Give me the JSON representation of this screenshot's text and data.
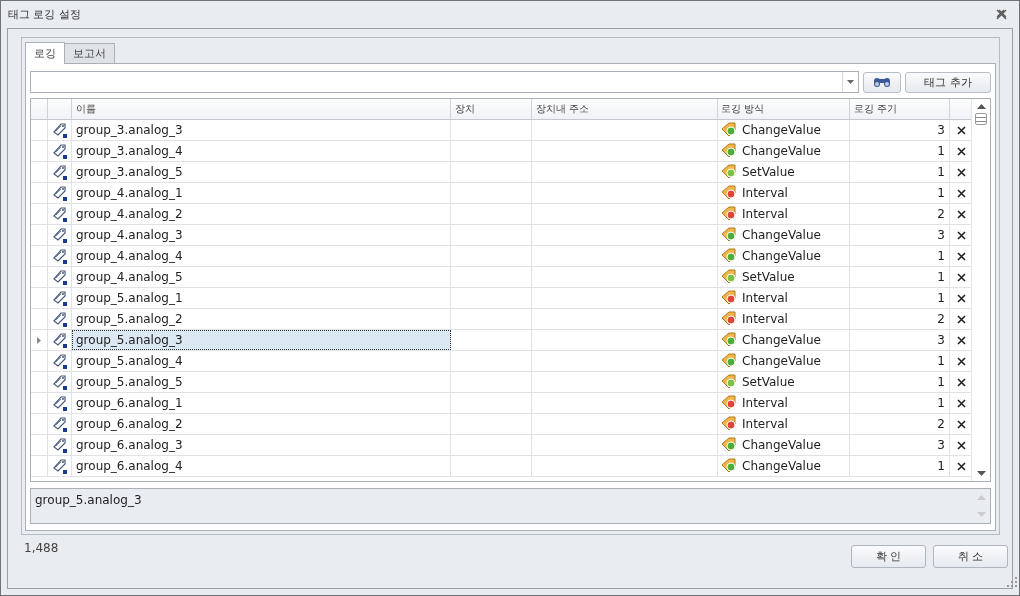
{
  "window": {
    "title": "태그 로깅 설정"
  },
  "tabs": [
    {
      "label": "로깅",
      "selected": true
    },
    {
      "label": "보고서",
      "selected": false
    }
  ],
  "toolbar": {
    "add_button": "태그 추가"
  },
  "table": {
    "columns": [
      "이름",
      "장치",
      "장치내 주소",
      "로깅 방식",
      "로깅 주기"
    ],
    "rows": [
      {
        "name": "group_3.analog_3",
        "method": {
          "kind": "change",
          "label": "ChangeValue"
        },
        "period": "3",
        "selected": false
      },
      {
        "name": "group_3.analog_4",
        "method": {
          "kind": "change",
          "label": "ChangeValue"
        },
        "period": "1",
        "selected": false
      },
      {
        "name": "group_3.analog_5",
        "method": {
          "kind": "set",
          "label": "SetValue"
        },
        "period": "1",
        "selected": false
      },
      {
        "name": "group_4.analog_1",
        "method": {
          "kind": "interval",
          "label": "Interval"
        },
        "period": "1",
        "selected": false
      },
      {
        "name": "group_4.analog_2",
        "method": {
          "kind": "interval",
          "label": "Interval"
        },
        "period": "2",
        "selected": false
      },
      {
        "name": "group_4.analog_3",
        "method": {
          "kind": "change",
          "label": "ChangeValue"
        },
        "period": "3",
        "selected": false
      },
      {
        "name": "group_4.analog_4",
        "method": {
          "kind": "change",
          "label": "ChangeValue"
        },
        "period": "1",
        "selected": false
      },
      {
        "name": "group_4.analog_5",
        "method": {
          "kind": "set",
          "label": "SetValue"
        },
        "period": "1",
        "selected": false
      },
      {
        "name": "group_5.analog_1",
        "method": {
          "kind": "interval",
          "label": "Interval"
        },
        "period": "1",
        "selected": false
      },
      {
        "name": "group_5.analog_2",
        "method": {
          "kind": "interval",
          "label": "Interval"
        },
        "period": "2",
        "selected": false
      },
      {
        "name": "group_5.analog_3",
        "method": {
          "kind": "change",
          "label": "ChangeValue"
        },
        "period": "3",
        "selected": true
      },
      {
        "name": "group_5.analog_4",
        "method": {
          "kind": "change",
          "label": "ChangeValue"
        },
        "period": "1",
        "selected": false
      },
      {
        "name": "group_5.analog_5",
        "method": {
          "kind": "set",
          "label": "SetValue"
        },
        "period": "1",
        "selected": false
      },
      {
        "name": "group_6.analog_1",
        "method": {
          "kind": "interval",
          "label": "Interval"
        },
        "period": "1",
        "selected": false
      },
      {
        "name": "group_6.analog_2",
        "method": {
          "kind": "interval",
          "label": "Interval"
        },
        "period": "2",
        "selected": false
      },
      {
        "name": "group_6.analog_3",
        "method": {
          "kind": "change",
          "label": "ChangeValue"
        },
        "period": "3",
        "selected": false
      },
      {
        "name": "group_6.analog_4",
        "method": {
          "kind": "change",
          "label": "ChangeValue"
        },
        "period": "1",
        "selected": false
      }
    ]
  },
  "description": "group_5.analog_3",
  "status": {
    "count": "1,488"
  },
  "buttons": [
    {
      "label": "확 인"
    },
    {
      "label": "취 소"
    }
  ]
}
